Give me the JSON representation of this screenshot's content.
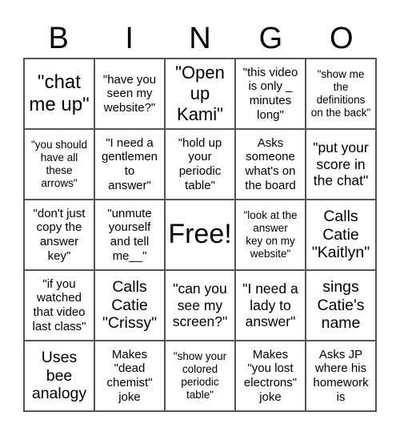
{
  "header": [
    "B",
    "I",
    "N",
    "G",
    "O"
  ],
  "cells": [
    {
      "text": "\"chat\nme up\"",
      "size": "s24"
    },
    {
      "text": "\"have you\nseen my\nwebsite?\"",
      "size": "s15"
    },
    {
      "text": "\"Open\nup\nKami\"",
      "size": "s22"
    },
    {
      "text": "\"this video\nis only _\nminutes\nlong\"",
      "size": "s15"
    },
    {
      "text": "\"show me\nthe\ndefinitions\non the back\"",
      "size": "s13"
    },
    {
      "text": "\"you should\nhave all\nthese\narrows\"",
      "size": "s13"
    },
    {
      "text": "\"I need a\ngentlemen\nto\nanswer\"",
      "size": "s15"
    },
    {
      "text": "\"hold up\nyour\nperiodic\ntable\"",
      "size": "s15"
    },
    {
      "text": "Asks\nsomeone\nwhat's on\nthe board",
      "size": "s15"
    },
    {
      "text": "\"put your\nscore in\nthe chat\"",
      "size": "s17"
    },
    {
      "text": "\"don't just\ncopy the\nanswer\nkey\"",
      "size": "s15"
    },
    {
      "text": "\"unmute\nyourself\nand tell\nme__\"",
      "size": "s15"
    },
    {
      "text": "Free!",
      "size": "s34"
    },
    {
      "text": "\"look at the\nanswer\nkey on my\nwebsite\"",
      "size": "s13"
    },
    {
      "text": "Calls\nCatie\n\"Kaitlyn\"",
      "size": "s19"
    },
    {
      "text": "\"if you\nwatched\nthat video\nlast class\"",
      "size": "s15"
    },
    {
      "text": "Calls\nCatie\n\"Crissy\"",
      "size": "s19"
    },
    {
      "text": "\"can you\nsee my\nscreen?\"",
      "size": "s17"
    },
    {
      "text": "\"I need a\nlady to\nanswer\"",
      "size": "s17"
    },
    {
      "text": "sings\nCatie's\nname",
      "size": "s19"
    },
    {
      "text": "Uses\nbee\nanalogy",
      "size": "s19"
    },
    {
      "text": "Makes\n\"dead\nchemist\"\njoke",
      "size": "s15"
    },
    {
      "text": "\"show your\ncolored\nperiodic\ntable\"",
      "size": "s13"
    },
    {
      "text": "Makes\n\"you lost\nelectrons\"\njoke",
      "size": "s15"
    },
    {
      "text": "Asks JP\nwhere his\nhomework\nis",
      "size": "s15"
    }
  ]
}
